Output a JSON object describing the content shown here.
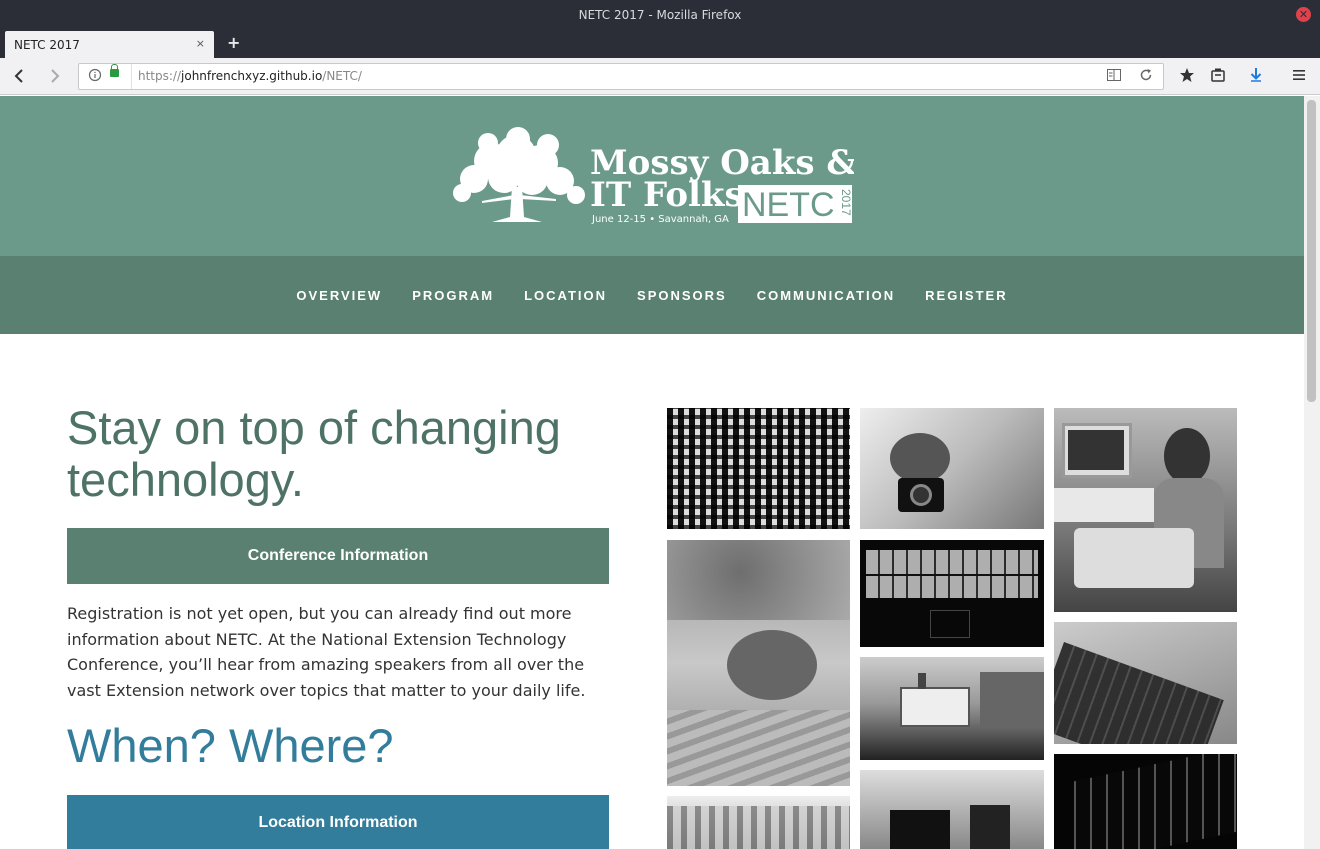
{
  "window": {
    "title": "NETC 2017 - Mozilla Firefox"
  },
  "tab": {
    "label": "NETC 2017",
    "close": "×",
    "new_tab": "+"
  },
  "address_bar": {
    "scheme": "https://",
    "host": "johnfrenchxyz.github.io",
    "path": "/NETC/"
  },
  "site": {
    "logo_text": {
      "line1": "Mossy Oaks &",
      "line2": "IT Folks",
      "brand": "NETC",
      "year": "2017",
      "date_place": "June 12-15 • Savannah, GA"
    },
    "nav": [
      {
        "label": "OVERVIEW"
      },
      {
        "label": "PROGRAM"
      },
      {
        "label": "LOCATION"
      },
      {
        "label": "SPONSORS"
      },
      {
        "label": "COMMUNICATION"
      },
      {
        "label": "REGISTER"
      }
    ],
    "headline": "Stay on top of changing technology.",
    "conference_button": "Conference Information",
    "intro_paragraph": "Registration is not yet open, but you can already find out more information about NETC. At the National Extension Technology Conference, you’ll hear from amazing speakers from all over the vast Extension network over topics that matter to your daily life.",
    "when_where": "When? Where?",
    "location_button": "Location Information"
  },
  "colors": {
    "hero": "#6b9a8b",
    "nav": "#5a8071",
    "heading": "#4e7366",
    "accent_blue": "#327d9b"
  },
  "icons": [
    "back-icon",
    "forward-icon",
    "info-icon",
    "lock-icon",
    "reader-view-icon",
    "reload-icon",
    "bookmark-star-icon",
    "library-icon",
    "download-icon",
    "menu-icon",
    "close-window-icon"
  ]
}
